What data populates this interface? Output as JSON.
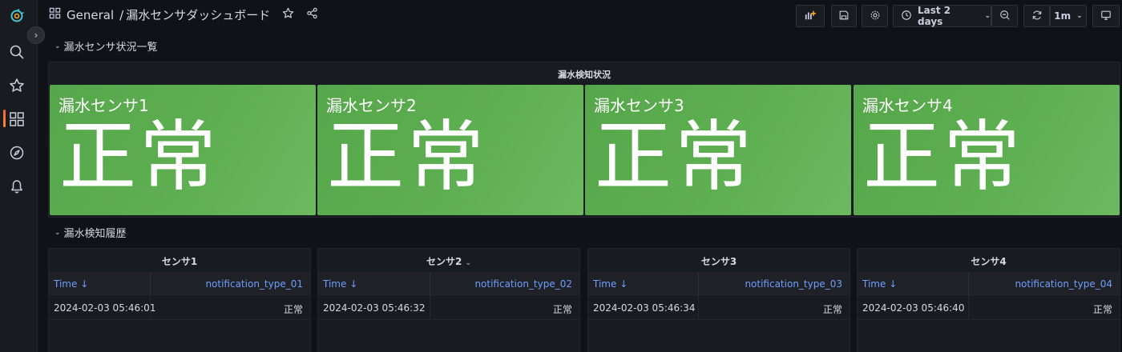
{
  "breadcrumb": {
    "folder": "General",
    "separator": "/",
    "dashboard": "漏水センサダッシュボード"
  },
  "toolbar": {
    "time_range": "Last 2 days",
    "refresh_interval": "1m"
  },
  "sidebar": {
    "icons": [
      "grafana-logo-icon",
      "search-icon",
      "star-icon",
      "dashboards-icon",
      "explore-icon",
      "alerting-bell-icon"
    ],
    "active": "dashboards-icon"
  },
  "rows": [
    {
      "title": "漏水センサ状況一覧"
    },
    {
      "title": "漏水検知履歴"
    }
  ],
  "status_panel": {
    "title": "漏水検知状況",
    "color": "#56a64b",
    "stats": [
      {
        "name": "漏水センサ1",
        "value": "正常"
      },
      {
        "name": "漏水センサ2",
        "value": "正常"
      },
      {
        "name": "漏水センサ3",
        "value": "正常"
      },
      {
        "name": "漏水センサ4",
        "value": "正常"
      }
    ]
  },
  "history_tables": [
    {
      "title": "センサ1",
      "col_time": "Time",
      "col_value": "notification_type_01",
      "rows": [
        {
          "time": "2024-02-03 05:46:01",
          "value": "正常"
        }
      ]
    },
    {
      "title": "センサ2",
      "col_time": "Time",
      "col_value": "notification_type_02",
      "rows": [
        {
          "time": "2024-02-03 05:46:32",
          "value": "正常"
        }
      ]
    },
    {
      "title": "センサ3",
      "col_time": "Time",
      "col_value": "notification_type_03",
      "rows": [
        {
          "time": "2024-02-03 05:46:34",
          "value": "正常"
        }
      ]
    },
    {
      "title": "センサ4",
      "col_time": "Time",
      "col_value": "notification_type_04",
      "rows": [
        {
          "time": "2024-02-03 05:46:40",
          "value": "正常"
        }
      ]
    }
  ],
  "colors": {
    "background": "#111217",
    "panel": "#181b1f",
    "link_blue": "#6e9fff",
    "ok_green": "#56a64b",
    "accent_orange": "#f55f3e"
  }
}
